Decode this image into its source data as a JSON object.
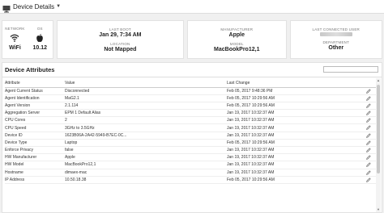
{
  "header": {
    "title": "Device Details"
  },
  "summary": {
    "network": {
      "label": "NETWORK",
      "value": "WiFi"
    },
    "os": {
      "label": "OS",
      "value": "10.12"
    },
    "last_boot": {
      "label": "LAST BOOT",
      "value": "Jan 29, 7:34 AM"
    },
    "location": {
      "label": "LOCATION",
      "value": "Not Mapped"
    },
    "manufacturer": {
      "label": "MANUFACTURER",
      "value": "Apple"
    },
    "model": {
      "label": "MODEL",
      "value": "MacBookPro12,1"
    },
    "last_user": {
      "label": "LAST CONNECTED USER"
    },
    "department": {
      "label": "DEPARTMENT",
      "value": "Other"
    }
  },
  "attributes": {
    "title": "Device Attributes",
    "columns": [
      "Attribute",
      "Value",
      "Last Change"
    ],
    "rows": [
      [
        "Agent Current Status",
        "Disconnected",
        "Feb 05, 2017 9:48:36 PM"
      ],
      [
        "Agent Identification",
        "MaG2.1",
        "Feb 05, 2017 10:29:56 AM"
      ],
      [
        "Agent Version",
        "2.1.114",
        "Feb 05, 2017 10:29:56 AM"
      ],
      [
        "Aggregation Server",
        "EPM 1 Default Alias",
        "Jan 19, 2017 10:32:37 AM"
      ],
      [
        "CPU Cores",
        "2",
        "Jan 19, 2017 10:32:37 AM"
      ],
      [
        "CPU Speed",
        "3GHz to 3.5GHz",
        "Jan 19, 2017 10:32:37 AM"
      ],
      [
        "Device ID",
        "1623B06A-2A42-5949-B7EC-0C...",
        "Jan 19, 2017 10:32:37 AM"
      ],
      [
        "Device Type",
        "Laptop",
        "Feb 05, 2017 10:29:56 AM"
      ],
      [
        "Enforce Privacy",
        "false",
        "Jan 19, 2017 10:32:37 AM"
      ],
      [
        "HW Manufacturer",
        "Apple",
        "Jan 19, 2017 10:32:37 AM"
      ],
      [
        "HW Model",
        "MacBookPro12,1",
        "Jan 19, 2017 10:32:37 AM"
      ],
      [
        "Hostname",
        "dimaex-mac",
        "Jan 19, 2017 10:32:37 AM"
      ],
      [
        "IP Address",
        "10.50.18.38",
        "Feb 05, 2017 10:29:56 AM"
      ]
    ]
  },
  "icons": {
    "menu": "desktop-icon",
    "network": "wifi-icon",
    "os": "apple-icon",
    "edit": "pencil-icon"
  },
  "colors": {
    "accent": "#222222",
    "card_bg": "#ffffff",
    "page_bg": "#f0f0f0"
  }
}
